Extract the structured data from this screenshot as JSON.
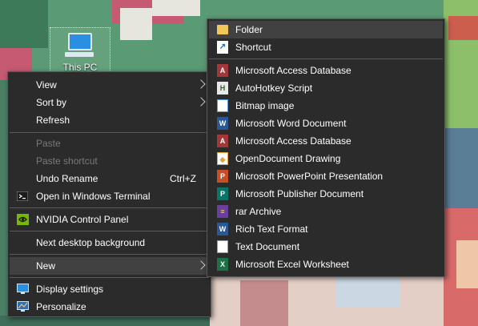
{
  "desktop": {
    "icon_label": "This PC"
  },
  "context_menu": {
    "items": [
      {
        "label": "View"
      },
      {
        "label": "Sort by"
      },
      {
        "label": "Refresh"
      },
      {
        "label": "Paste"
      },
      {
        "label": "Paste shortcut"
      },
      {
        "label": "Undo Rename",
        "shortcut": "Ctrl+Z"
      },
      {
        "label": "Open in Windows Terminal"
      },
      {
        "label": "NVIDIA Control Panel"
      },
      {
        "label": "Next desktop background"
      },
      {
        "label": "New"
      },
      {
        "label": "Display settings"
      },
      {
        "label": "Personalize"
      }
    ]
  },
  "new_submenu": {
    "items": [
      {
        "label": "Folder"
      },
      {
        "label": "Shortcut"
      },
      {
        "label": "Microsoft Access Database"
      },
      {
        "label": "AutoHotkey Script"
      },
      {
        "label": "Bitmap image"
      },
      {
        "label": "Microsoft Word Document"
      },
      {
        "label": "Microsoft Access Database"
      },
      {
        "label": "OpenDocument Drawing"
      },
      {
        "label": "Microsoft PowerPoint Presentation"
      },
      {
        "label": "Microsoft Publisher Document"
      },
      {
        "label": "rar Archive"
      },
      {
        "label": "Rich Text Format"
      },
      {
        "label": "Text Document"
      },
      {
        "label": "Microsoft Excel Worksheet"
      }
    ]
  },
  "colors": {
    "menu_bg": "#2b2b2b",
    "highlight": "#414141",
    "disabled_text": "#7a7a7a"
  }
}
